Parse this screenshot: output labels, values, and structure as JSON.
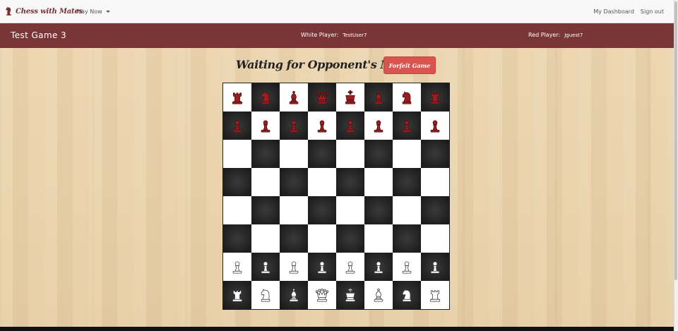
{
  "brand": {
    "name": "Chess with Mates"
  },
  "nav": {
    "play_now": "Play Now",
    "dashboard": "My Dashboard",
    "sign_out": "Sign out"
  },
  "game": {
    "title": "Test Game 3",
    "white_label": "White Player:",
    "white_name": "TestUser7",
    "red_label": "Red Player:",
    "red_name": "Jguest7"
  },
  "status": {
    "message": "Waiting for Opponent's Move",
    "forfeit_label": "Forfeit Game"
  },
  "colors": {
    "brand": "#7a3537",
    "red_piece": "#9a1f22",
    "forfeit": "#d9534f"
  },
  "board": {
    "rows": [
      [
        "red-rook",
        "red-knight",
        "red-bishop",
        "red-queen",
        "red-king",
        "red-bishop",
        "red-knight",
        "red-rook"
      ],
      [
        "red-pawn",
        "red-pawn",
        "red-pawn",
        "red-pawn",
        "red-pawn",
        "red-pawn",
        "red-pawn",
        "red-pawn"
      ],
      [
        "",
        "",
        "",
        "",
        "",
        "",
        "",
        ""
      ],
      [
        "",
        "",
        "",
        "",
        "",
        "",
        "",
        ""
      ],
      [
        "",
        "",
        "",
        "",
        "",
        "",
        "",
        ""
      ],
      [
        "",
        "",
        "",
        "",
        "",
        "",
        "",
        ""
      ],
      [
        "white-pawn",
        "white-pawn",
        "white-pawn",
        "white-pawn",
        "white-pawn",
        "white-pawn",
        "white-pawn",
        "white-pawn"
      ],
      [
        "white-rook",
        "white-knight",
        "white-bishop",
        "white-queen",
        "white-king",
        "white-bishop",
        "white-knight",
        "white-rook"
      ]
    ]
  }
}
